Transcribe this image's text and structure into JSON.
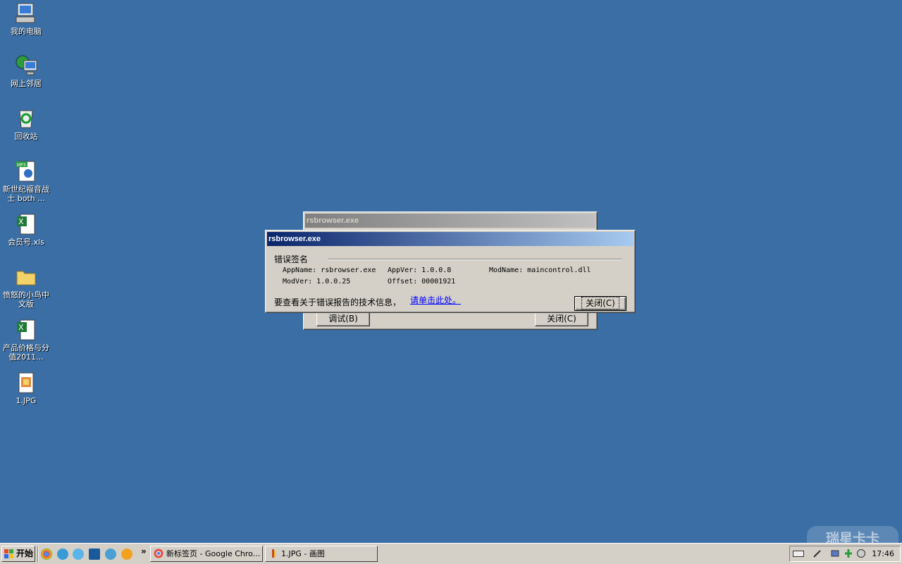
{
  "desktop": {
    "icons": [
      {
        "label": "我的电脑",
        "icon": "my-computer-icon"
      },
      {
        "label": "网上邻居",
        "icon": "network-places-icon"
      },
      {
        "label": "回收站",
        "icon": "recycle-bin-icon"
      },
      {
        "label": "新世纪福音战士 both ...",
        "icon": "mp3-file-icon"
      },
      {
        "label": "会员号.xls",
        "icon": "excel-file-icon"
      },
      {
        "label": "愤怒的小鸟中文版",
        "icon": "folder-icon"
      },
      {
        "label": "产品价格与分值2011...",
        "icon": "excel-file-icon"
      },
      {
        "label": "1.JPG",
        "icon": "jpg-file-icon"
      }
    ]
  },
  "back_dialog": {
    "title": "rsbrowser.exe",
    "debug_label": "调试(B)",
    "close_label": "关闭(C)"
  },
  "error_dialog": {
    "title": "rsbrowser.exe",
    "group_label": "错误签名",
    "app_name": "AppName: rsbrowser.exe",
    "app_ver": "AppVer: 1.0.0.8",
    "mod_name": "ModName: maincontrol.dll",
    "mod_ver": "ModVer: 1.0.0.25",
    "offset": "Offset: 00001921",
    "info_text": "要查看关于错误报告的技术信息，",
    "link_text": "请单击此处。",
    "close_label": "关闭(C)"
  },
  "taskbar": {
    "start_label": "开始",
    "overflow": "»",
    "tasks": [
      {
        "label": "新标签页 - Google Chro..."
      },
      {
        "label": "1.JPG - 画图"
      }
    ],
    "clock": "17:46"
  },
  "watermark": "瑞星卡卡",
  "colors": {
    "desktop": "#3a6ea5",
    "title_active": "#0a246a",
    "title_inactive": "#808080",
    "face": "#d4d0c8"
  }
}
